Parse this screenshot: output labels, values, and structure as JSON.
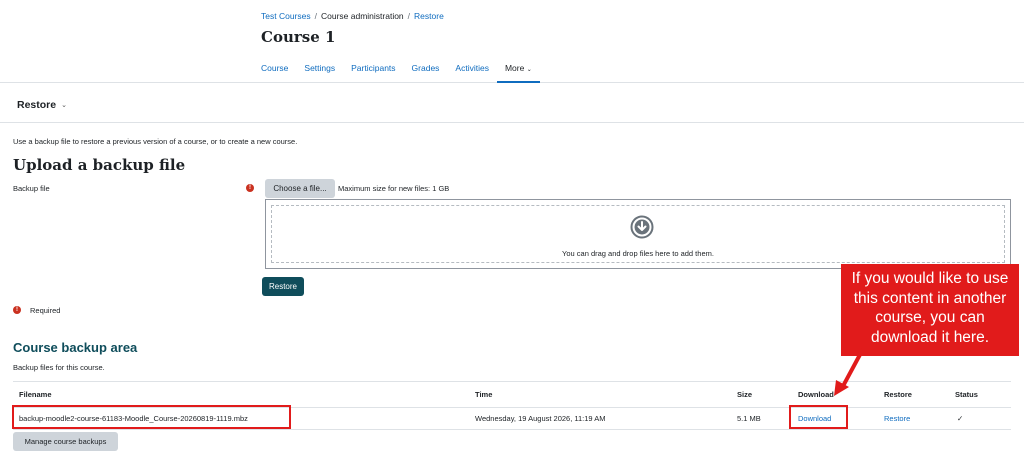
{
  "breadcrumb": [
    {
      "label": "Test Courses",
      "link": true
    },
    {
      "label": "Course administration",
      "link": false
    },
    {
      "label": "Restore",
      "link": true
    }
  ],
  "course_title": "Course 1",
  "nav": {
    "items": [
      "Course",
      "Settings",
      "Participants",
      "Grades",
      "Activities"
    ],
    "more_label": "More"
  },
  "page_menu": {
    "label": "Restore"
  },
  "upload": {
    "intro": "Use a backup file to restore a previous version of a course, or to create a new course.",
    "heading": "Upload a backup file",
    "field_label": "Backup file",
    "choose_button": "Choose a file...",
    "max_size": "Maximum size for new files: 1 GB",
    "drop_text": "You can drag and drop files here to add them.",
    "restore_button": "Restore",
    "required_label": "Required"
  },
  "backup_area": {
    "heading": "Course backup area",
    "description": "Backup files for this course.",
    "columns": [
      "Filename",
      "Time",
      "Size",
      "Download",
      "Restore",
      "Status"
    ],
    "rows": [
      {
        "filename": "backup-moodle2-course-61183-Moodle_Course-20260819-1119.mbz",
        "time": "Wednesday, 19 August 2026, 11:19 AM",
        "size": "5.1 MB",
        "download": "Download",
        "restore": "Restore",
        "status": "✓"
      }
    ],
    "manage_button": "Manage course backups"
  },
  "callout": {
    "text": "If you would like to use this content in another course, you can download it here."
  },
  "colors": {
    "link": "#0f6cbf",
    "primary_button": "#0f4d5b",
    "annotation_red": "#e11b1b",
    "required_red": "#ca3120"
  }
}
